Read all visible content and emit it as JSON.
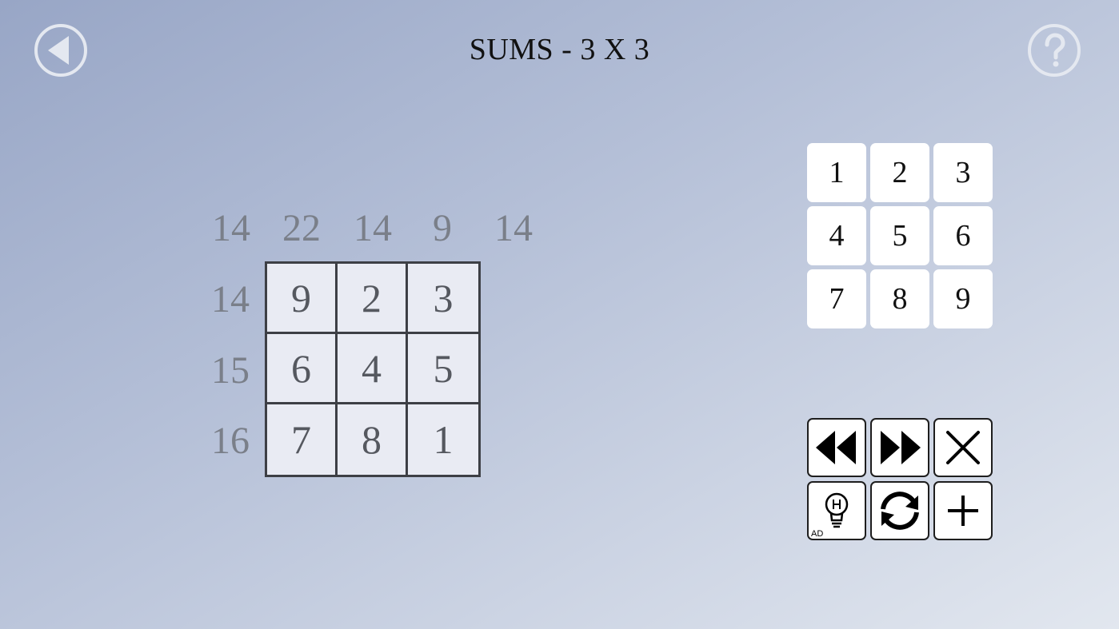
{
  "header": {
    "title": "SUMS - 3 X 3",
    "back_icon": "back-arrow-icon",
    "help_icon": "help-question-icon"
  },
  "puzzle": {
    "column_clues": [
      "14",
      "22",
      "14",
      "9",
      "14"
    ],
    "row_clues": [
      "14",
      "15",
      "16"
    ],
    "grid": [
      [
        "9",
        "2",
        "3"
      ],
      [
        "6",
        "4",
        "5"
      ],
      [
        "7",
        "8",
        "1"
      ]
    ]
  },
  "numpad": {
    "keys": [
      "1",
      "2",
      "3",
      "4",
      "5",
      "6",
      "7",
      "8",
      "9"
    ]
  },
  "tools": {
    "undo_icon": "rewind-icon",
    "redo_icon": "fast-forward-icon",
    "clear_icon": "close-icon",
    "hint_icon": "lightbulb-hint-icon",
    "hint_ad_label": "AD",
    "restart_icon": "refresh-icon",
    "new_icon": "plus-icon"
  },
  "colors": {
    "clue_text": "#7a7f89",
    "cell_background": "#e9ebf3",
    "grid_lines": "#3d3f45",
    "button_outline": "#e4e8f0"
  }
}
